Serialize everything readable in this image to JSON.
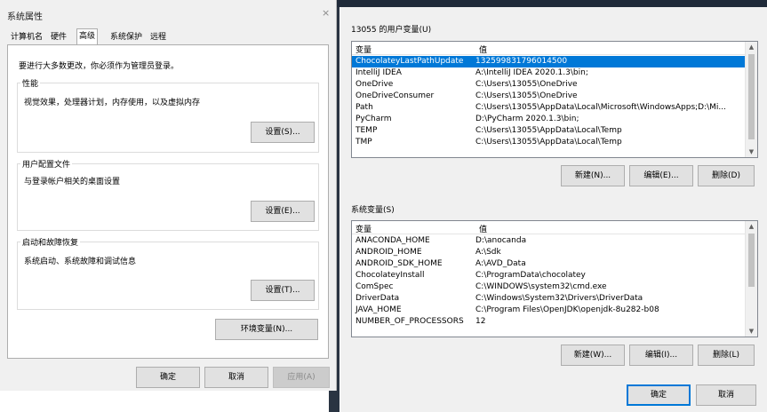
{
  "left_dialog": {
    "title": "系统属性",
    "close_glyph": "×",
    "tabs": [
      "计算机名",
      "硬件",
      "高级",
      "系统保护",
      "远程"
    ],
    "admin_note": "要进行大多数更改，你必须作为管理员登录。",
    "performance": {
      "title": "性能",
      "desc": "视觉效果，处理器计划，内存使用，以及虚拟内存",
      "button": "设置(S)..."
    },
    "user_profiles": {
      "title": "用户配置文件",
      "desc": "与登录帐户相关的桌面设置",
      "button": "设置(E)..."
    },
    "startup": {
      "title": "启动和故障恢复",
      "desc": "系统启动、系统故障和调试信息",
      "button": "设置(T)..."
    },
    "env_button": "环境变量(N)...",
    "ok": "确定",
    "cancel": "取消",
    "apply": "应用(A)"
  },
  "right_dialog": {
    "user_vars_label": "13055 的用户变量(U)",
    "col_var": "变量",
    "col_val": "值",
    "user_vars": [
      {
        "name": "ChocolateyLastPathUpdate",
        "value": "132599831796014500",
        "selected": true
      },
      {
        "name": "IntelliJ IDEA",
        "value": "A:\\IntelliJ IDEA 2020.1.3\\bin;"
      },
      {
        "name": "OneDrive",
        "value": "C:\\Users\\13055\\OneDrive"
      },
      {
        "name": "OneDriveConsumer",
        "value": "C:\\Users\\13055\\OneDrive"
      },
      {
        "name": "Path",
        "value": "C:\\Users\\13055\\AppData\\Local\\Microsoft\\WindowsApps;D:\\Mi..."
      },
      {
        "name": "PyCharm",
        "value": "D:\\PyCharm 2020.1.3\\bin;"
      },
      {
        "name": "TEMP",
        "value": "C:\\Users\\13055\\AppData\\Local\\Temp"
      },
      {
        "name": "TMP",
        "value": "C:\\Users\\13055\\AppData\\Local\\Temp"
      }
    ],
    "user_buttons": {
      "new": "新建(N)...",
      "edit": "编辑(E)...",
      "delete": "删除(D)"
    },
    "sys_vars_label": "系统变量(S)",
    "sys_vars": [
      {
        "name": "ANACONDA_HOME",
        "value": "D:\\anocanda"
      },
      {
        "name": "ANDROID_HOME",
        "value": "A:\\Sdk"
      },
      {
        "name": "ANDROID_SDK_HOME",
        "value": "A:\\AVD_Data"
      },
      {
        "name": "ChocolateyInstall",
        "value": "C:\\ProgramData\\chocolatey"
      },
      {
        "name": "ComSpec",
        "value": "C:\\WINDOWS\\system32\\cmd.exe"
      },
      {
        "name": "DriverData",
        "value": "C:\\Windows\\System32\\Drivers\\DriverData"
      },
      {
        "name": "JAVA_HOME",
        "value": "C:\\Program Files\\OpenJDK\\openjdk-8u282-b08"
      },
      {
        "name": "NUMBER_OF_PROCESSORS",
        "value": "12"
      }
    ],
    "sys_buttons": {
      "new": "新建(W)...",
      "edit": "编辑(I)...",
      "delete": "删除(L)"
    },
    "ok": "确定",
    "cancel": "取消"
  }
}
